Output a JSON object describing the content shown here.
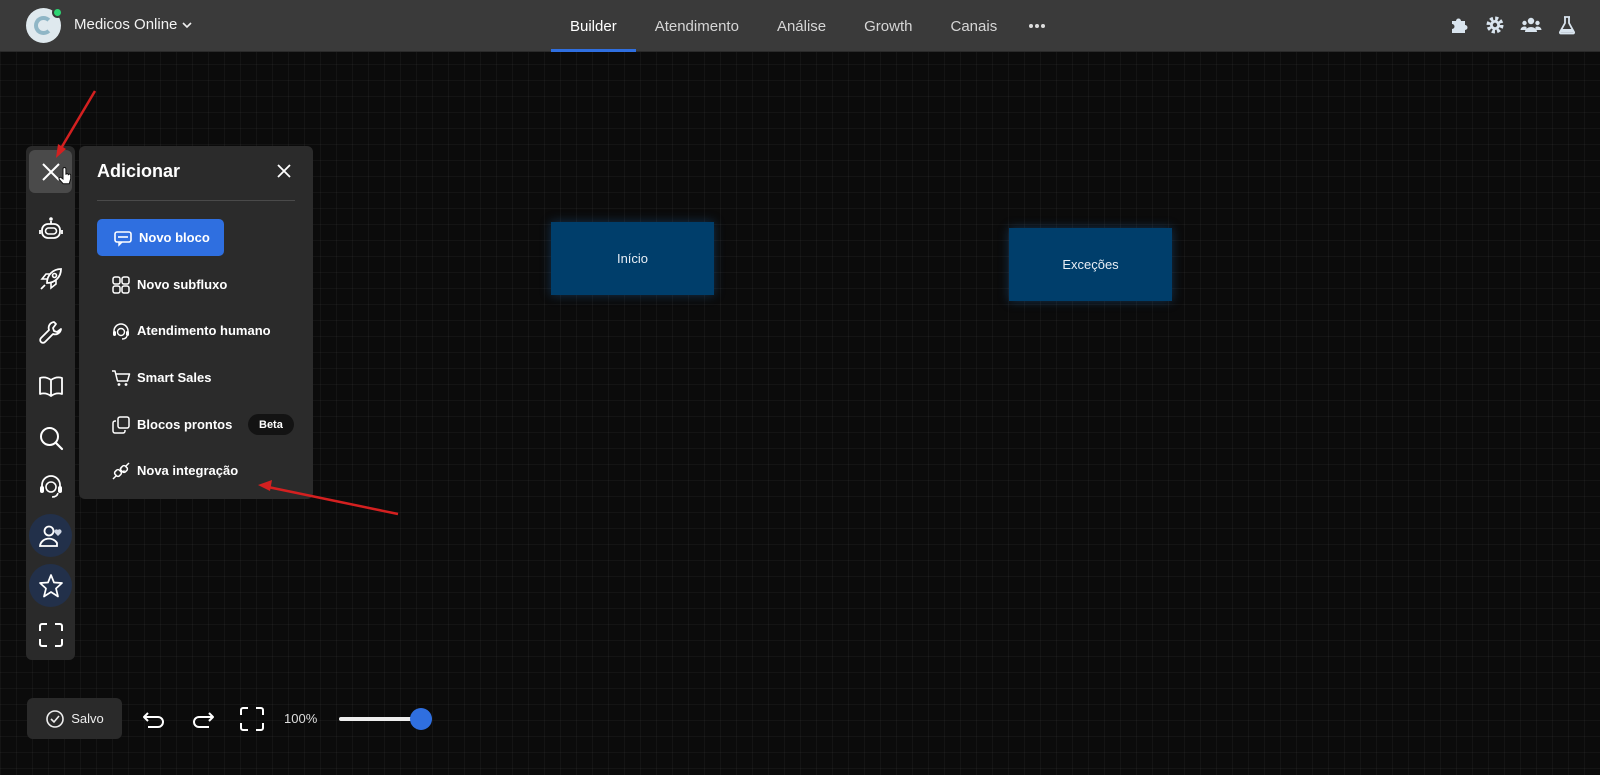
{
  "header": {
    "workspace_name": "Medicos Online",
    "nav": [
      {
        "label": "Builder",
        "active": true
      },
      {
        "label": "Atendimento",
        "active": false
      },
      {
        "label": "Análise",
        "active": false
      },
      {
        "label": "Growth",
        "active": false
      },
      {
        "label": "Canais",
        "active": false
      }
    ],
    "more_icon": "ellipsis-icon",
    "right_icons": [
      "puzzle-icon",
      "gear-icon",
      "team-icon",
      "flask-icon"
    ]
  },
  "rail": {
    "icons": [
      "close-icon",
      "bot-icon",
      "rocket-icon",
      "wrench-icon",
      "book-icon",
      "search-icon",
      "headset-icon",
      "user-favorite-icon",
      "star-icon",
      "focus-frame-icon"
    ]
  },
  "panel": {
    "title": "Adicionar",
    "items": [
      {
        "label": "Novo bloco",
        "icon": "message-block-icon"
      },
      {
        "label": "Novo subfluxo",
        "icon": "grid-icon"
      },
      {
        "label": "Atendimento humano",
        "icon": "headset-icon"
      },
      {
        "label": "Smart Sales",
        "icon": "cart-icon"
      },
      {
        "label": "Blocos prontos",
        "icon": "copy-blocks-icon",
        "badge": "Beta"
      },
      {
        "label": "Nova integração",
        "icon": "plug-icon"
      }
    ]
  },
  "canvas": {
    "blocks": [
      {
        "label": "Início"
      },
      {
        "label": "Exceções"
      }
    ]
  },
  "toolbar": {
    "saved_label": "Salvo",
    "zoom_label": "100%",
    "zoom_value": 1.0
  },
  "colors": {
    "accent": "#2f6fe0",
    "block": "#003e6b",
    "topbar": "#3a3a3a",
    "annotation_arrow": "#d42020"
  }
}
